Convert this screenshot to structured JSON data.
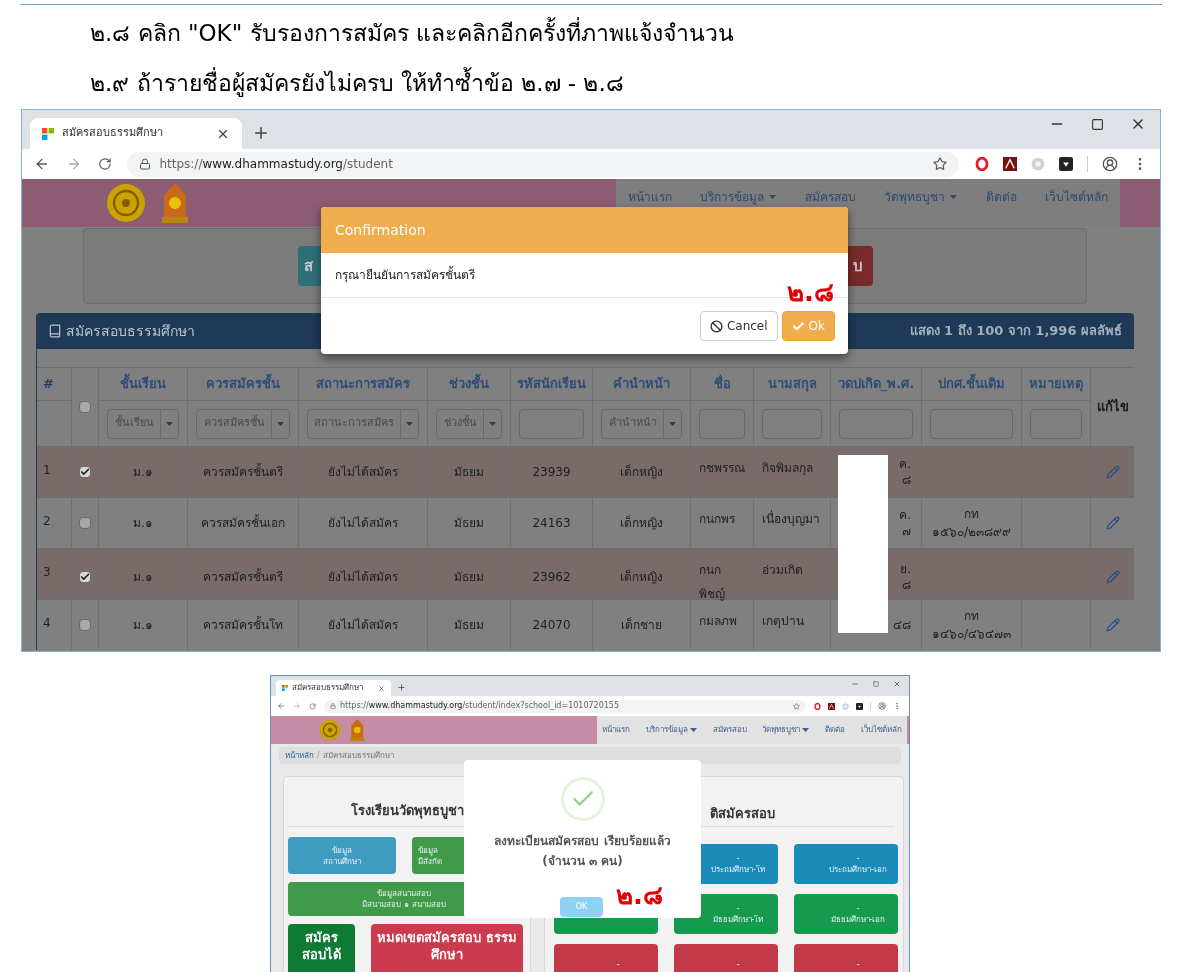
{
  "instructions": [
    {
      "text": "๒.๘ คลิก \"OK\" รับรองการสมัคร และคลิกอีกครั้งที่ภาพแจ้งจำนวน"
    },
    {
      "text": "๒.๙ ถ้ารายชื่อผู้สมัครยังไม่ครบ ให้ทำซ้ำข้อ ๒.๗ - ๒.๘"
    }
  ],
  "screenshot_1": {
    "browser": {
      "tab_title": "สมัครสอบธรรมศึกษา",
      "url_scheme": "https://",
      "url_host": "www.dhammastudy.org",
      "url_path": "/student"
    },
    "nav": [
      {
        "label": "หน้าแรก",
        "dropdown": false
      },
      {
        "label": "บริการข้อมูล",
        "dropdown": true
      },
      {
        "label": "สมัครสอบ",
        "dropdown": false
      },
      {
        "label": "วัดพุทธบูชา",
        "dropdown": true
      },
      {
        "label": "ติดต่อ",
        "dropdown": false
      },
      {
        "label": "เว็บไซต์หลัก",
        "dropdown": false
      }
    ],
    "partial_buttons": [
      {
        "label": "ส",
        "kind": "info"
      },
      {
        "label": "บ",
        "kind": "danger"
      }
    ],
    "panel": {
      "title": "สมัครสอบธรรมศึกษา",
      "summary": "แสดง 1 ถึง 100 จาก 1,996 ผลลัพธ์"
    },
    "table": {
      "columns": [
        {
          "kind": "number",
          "label": "#"
        },
        {
          "kind": "select_all",
          "checked": false
        },
        {
          "kind": "field",
          "label": "ชั้นเรียน",
          "filter": {
            "kind": "select",
            "placeholder": "ชั้นเรียน"
          }
        },
        {
          "kind": "field",
          "label": "ควรสมัครชั้น",
          "filter": {
            "kind": "select",
            "placeholder": "ควรสมัครชั้น"
          }
        },
        {
          "kind": "field",
          "label": "สถานะการสมัคร",
          "filter": {
            "kind": "select",
            "placeholder": "สถานะการสมัคร"
          }
        },
        {
          "kind": "field",
          "label": "ช่วงชั้น",
          "filter": {
            "kind": "select",
            "placeholder": "ช่วงชั้น"
          }
        },
        {
          "kind": "field",
          "label": "รหัสนักเรียน",
          "filter": {
            "kind": "text"
          }
        },
        {
          "kind": "field",
          "label": "คำนำหน้า",
          "filter": {
            "kind": "select",
            "placeholder": "คำนำหน้า"
          }
        },
        {
          "kind": "field",
          "label": "ชื่อ",
          "filter": {
            "kind": "text"
          }
        },
        {
          "kind": "field",
          "label": "นามสกุล",
          "filter": {
            "kind": "text"
          }
        },
        {
          "kind": "field",
          "label": "วดปเกิด_พ.ศ.",
          "filter": {
            "kind": "text"
          }
        },
        {
          "kind": "field",
          "label": "ปกศ.ชั้นเดิม",
          "filter": {
            "kind": "text"
          }
        },
        {
          "kind": "field",
          "label": "หมายเหตุ",
          "filter": {
            "kind": "text"
          }
        },
        {
          "kind": "edit",
          "label": "แก้ไข"
        }
      ],
      "rows": [
        {
          "number": "1",
          "selected": true,
          "checked": true,
          "grade": "ม.๑",
          "level_to_apply": "ควรสมัครชั้นตรี",
          "status": "ยังไม่ได้สมัคร",
          "range": "มัธยม",
          "student_id": "23939",
          "prefix": "เด็กหญิง",
          "first_name": "กชพรรณ",
          "last_name": "กิจพิมลกุล",
          "birth": [
            "ค.",
            "๘"
          ]
        },
        {
          "number": "2",
          "selected": false,
          "checked": false,
          "grade": "ม.๑",
          "level_to_apply": "ควรสมัครชั้นเอก",
          "status": "ยังไม่ได้สมัคร",
          "range": "มัธยม",
          "student_id": "24163",
          "prefix": "เด็กหญิง",
          "first_name": "กนกพร",
          "last_name": "เนื่องบุญมา",
          "birth": [
            "ค.",
            "๗"
          ],
          "previous_cert": "กท ๑๕๖๐/๒๓๘๙๙"
        },
        {
          "number": "3",
          "selected": true,
          "checked": true,
          "grade": "ม.๑",
          "level_to_apply": "ควรสมัครชั้นตรี",
          "status": "ยังไม่ได้สมัคร",
          "range": "มัธยม",
          "student_id": "23962",
          "prefix": "เด็กหญิง",
          "first_name": "กนก พิชญ์",
          "last_name": "อ่วมเกิด",
          "birth": [
            "ย.",
            "๘"
          ]
        },
        {
          "number": "4",
          "selected": false,
          "checked": false,
          "grade": "ม.๑",
          "level_to_apply": "ควรสมัครชั้นโท",
          "status": "ยังไม่ได้สมัคร",
          "range": "มัธยม",
          "student_id": "24070",
          "prefix": "เด็กชาย",
          "first_name": "กมลภพ",
          "last_name": "เกตุปาน",
          "birth": [
            "๔๘"
          ],
          "previous_cert": "กท ๑๔๖๐/๔๖๔๗๓"
        }
      ]
    },
    "modal": {
      "title": "Confirmation",
      "message": "กรุณายืนยันการสมัครชั้นตรี",
      "buttons": [
        {
          "label": "Cancel",
          "kind": "default"
        },
        {
          "label": "Ok",
          "kind": "primary"
        }
      ],
      "annotation": "๒.๘"
    }
  },
  "screenshot_2": {
    "browser": {
      "tab_title": "สมัครสอบธรรมศึกษา",
      "url_scheme": "https://",
      "url_host": "www.dhammastudy.org",
      "url_path": "/student/index?school_id=1010720155"
    },
    "nav": [
      {
        "label": "หน้าแรก",
        "dropdown": false
      },
      {
        "label": "บริการข้อมูล",
        "dropdown": true
      },
      {
        "label": "สมัครสอบ",
        "dropdown": false
      },
      {
        "label": "วัดพุทธบูชา",
        "dropdown": true
      },
      {
        "label": "ติดต่อ",
        "dropdown": false
      },
      {
        "label": "เว็บไซต์หลัก",
        "dropdown": false
      }
    ],
    "breadcrumb": {
      "items": [
        "หน้าหลัก",
        "สมัครสอบธรรมศึกษา"
      ],
      "separator": "/"
    },
    "left_panel": {
      "title": "โรงเรียนวัดพุทธบูชา",
      "info_tiles": [
        {
          "kind": "info",
          "lines": [
            "ข้อมูล",
            "สถานศึกษา"
          ]
        },
        {
          "kind": "success",
          "lines": [
            "ข้อมูล",
            "มีสังกัด"
          ]
        }
      ],
      "field_tile": {
        "kind": "success",
        "lines": [
          "ข้อมูลสนามสอบ",
          "มีสนามสอบ ๑ สนามสอบ"
        ]
      },
      "status_tile": {
        "kind": "open",
        "text": "สมัคร สอบได้"
      },
      "deadline_tile": {
        "kind": "danger",
        "text": "หมดเขตสมัครสอบ ธรรมศึกษา"
      }
    },
    "right_panel": {
      "title": "ติสมัครสอบ",
      "tiles": [
        {
          "kind": "info",
          "value": "-",
          "label": "ประถมศึกษา-โท"
        },
        {
          "kind": "info",
          "value": "-",
          "label": "ประถมศึกษา-เอก"
        },
        {
          "kind": "success"
        },
        {
          "kind": "success",
          "value": "-",
          "label": "มัธยมศึกษา-โท"
        },
        {
          "kind": "success",
          "value": "-",
          "label": "มัธยมศึกษา-เอก"
        },
        {
          "kind": "danger",
          "value": "-"
        },
        {
          "kind": "danger",
          "value": "-"
        },
        {
          "kind": "danger",
          "value": "-"
        }
      ]
    },
    "modal": {
      "message": "ลงทะเบียนสมัครสอบ เรียบร้อยแล้ว (จำนวน ๓ คน)",
      "button": "OK",
      "annotation": "๒.๘"
    }
  }
}
